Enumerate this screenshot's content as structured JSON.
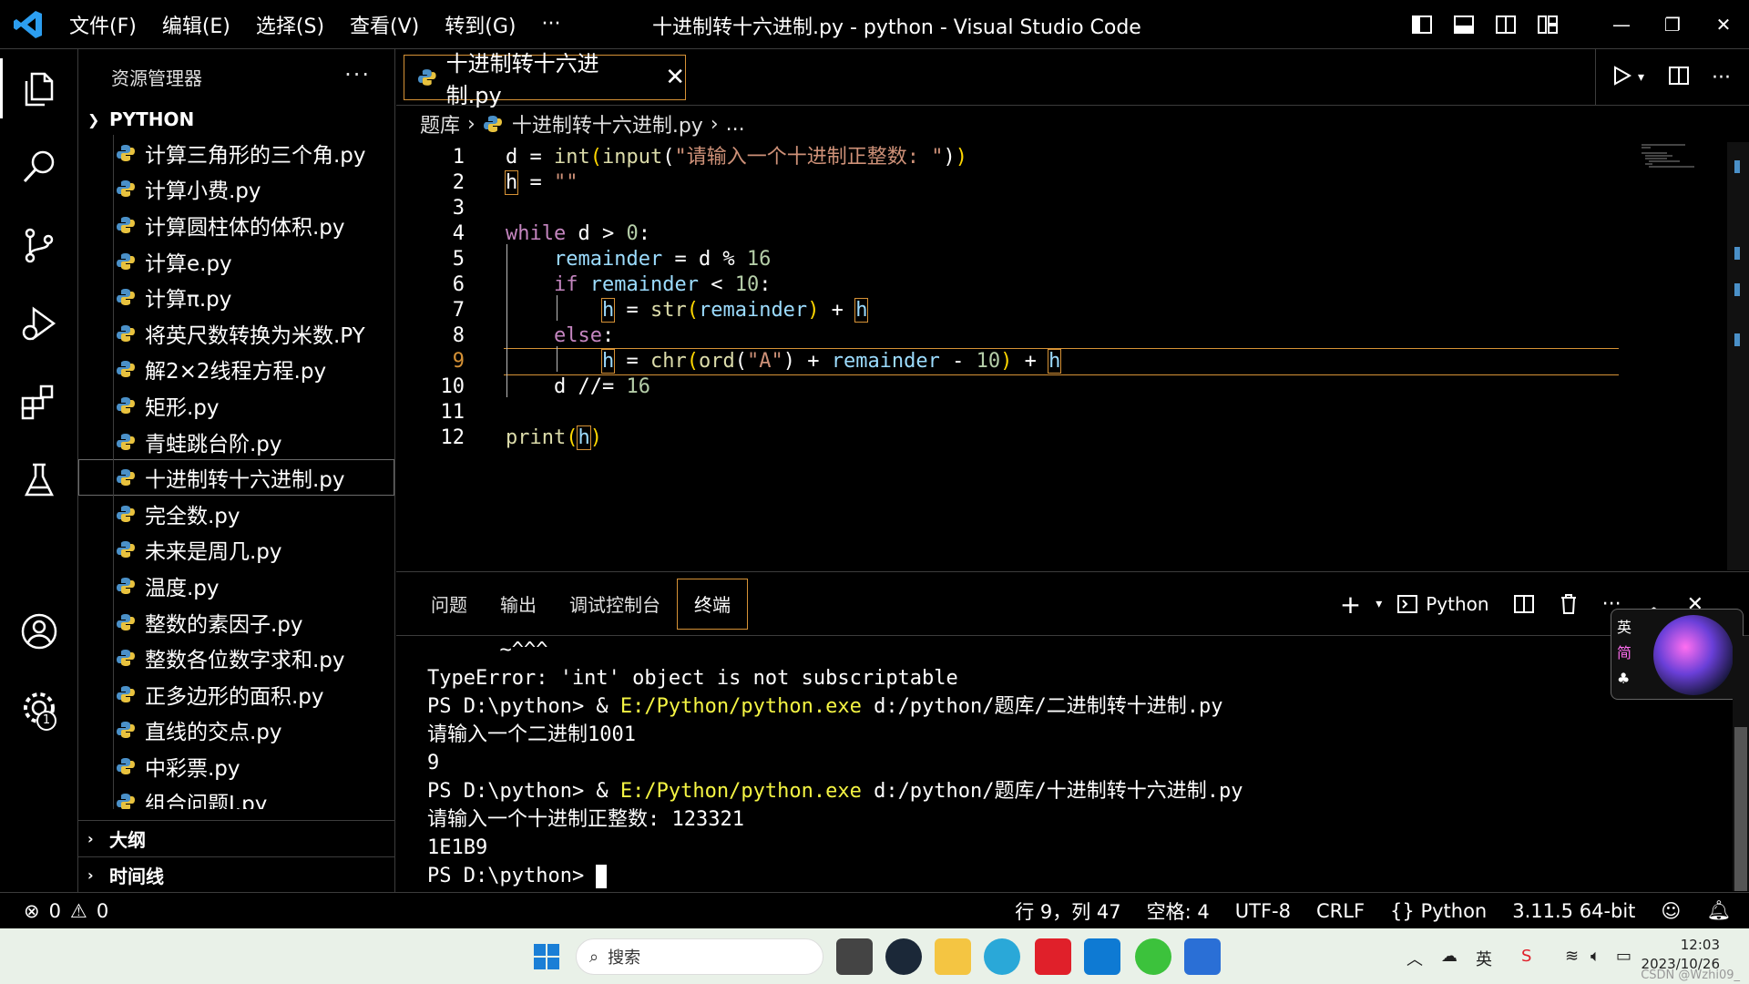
{
  "titlebar": {
    "menus": [
      "文件(F)",
      "编辑(E)",
      "选择(S)",
      "查看(V)",
      "转到(G)",
      "···"
    ],
    "title": "十进制转十六进制.py - python - Visual Studio Code"
  },
  "sidebar": {
    "header": "资源管理器",
    "folder": "PYTHON",
    "files": [
      "计算三角形的三个角.py",
      "计算小费.py",
      "计算圆柱体的体积.py",
      "计算e.py",
      "计算π.py",
      "将英尺数转换为米数.PY",
      "解2×2线程方程.py",
      "矩形.py",
      "青蛙跳台阶.py",
      "十进制转十六进制.py",
      "完全数.py",
      "未来是周几.py",
      "温度.py",
      "整数的素因子.py",
      "整数各位数字求和.py",
      "正多边形的面积.py",
      "直线的交点.py",
      "中彩票.py",
      "组合问题I.py"
    ],
    "selected_index": 9,
    "outline": "大纲",
    "timeline": "时间线"
  },
  "editor": {
    "tab_label": "十进制转十六进制.py",
    "breadcrumb": [
      "题库",
      "十进制转十六进制.py",
      "..."
    ],
    "line_numbers": [
      "1",
      "2",
      "3",
      "4",
      "5",
      "6",
      "7",
      "8",
      "9",
      "10",
      "11",
      "12"
    ],
    "current_line": 9
  },
  "panel": {
    "tabs": [
      "问题",
      "输出",
      "调试控制台",
      "终端"
    ],
    "active_tab": "终端",
    "shell": "Python",
    "terminal_lines": [
      "      ~^^^",
      "TypeError: 'int' object is not subscriptable",
      "请输入一个二进制1001",
      "9",
      "请输入一个十进制正整数: 123321",
      "1E1B9"
    ],
    "run1_prompt": "PS D:\\python> & ",
    "run1_exe": "E:/Python/python.exe",
    "run1_script": " d:/python/题库/二进制转十进制.py",
    "run2_prompt": "PS D:\\python> & ",
    "run2_exe": "E:/Python/python.exe",
    "run2_script": " d:/python/题库/十进制转十六进制.py",
    "final_prompt": "PS D:\\python> ",
    "ime_en": "英",
    "ime_cn": "简"
  },
  "statusbar": {
    "errors": "0",
    "warnings": "0",
    "position": "行 9，列 47",
    "spaces": "空格: 4",
    "encoding": "UTF-8",
    "eol": "CRLF",
    "language": "Python",
    "interpreter": "3.11.5 64-bit"
  },
  "taskbar": {
    "search_placeholder": "搜索",
    "time": "12:03",
    "date": "2023/10/26",
    "ime": "英",
    "watermark": "CSDN @Wzhi09_"
  },
  "colors": {
    "accent": "#d69236",
    "keyword": "#c586c0",
    "function": "#dcdcaa",
    "string": "#ce9178",
    "number": "#b5cea8",
    "variable": "#9cdcfe",
    "vscode_blue": "#0e7ad3"
  }
}
